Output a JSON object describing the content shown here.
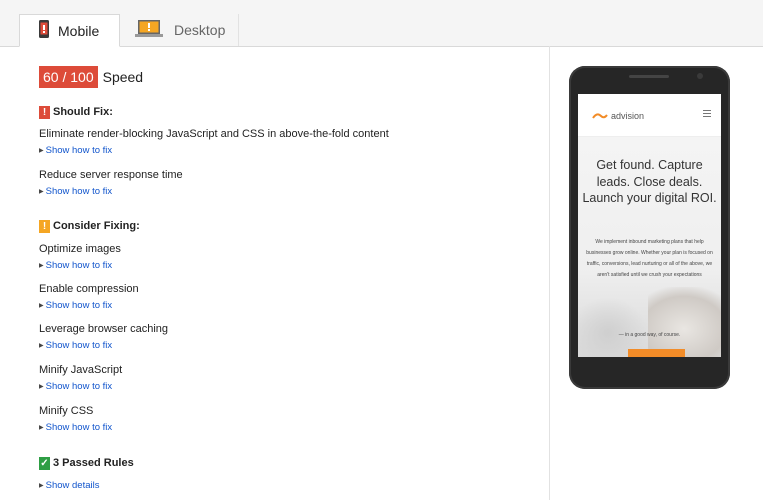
{
  "tabs": [
    {
      "label": "Mobile",
      "icon": "mobile-icon",
      "active": true
    },
    {
      "label": "Desktop",
      "icon": "desktop-icon",
      "active": false
    }
  ],
  "score": {
    "value": "60 / 100",
    "label": "Speed",
    "color": "#dd4b39"
  },
  "should_fix": {
    "heading": "Should Fix:",
    "badge_color": "#dd4b39",
    "rules": [
      {
        "title": "Eliminate render-blocking JavaScript and CSS in above-the-fold content",
        "link": "Show how to fix"
      },
      {
        "title": "Reduce server response time",
        "link": "Show how to fix"
      }
    ]
  },
  "consider_fixing": {
    "heading": "Consider Fixing:",
    "badge_color": "#f5a623",
    "rules": [
      {
        "title": "Optimize images",
        "link": "Show how to fix"
      },
      {
        "title": "Enable compression",
        "link": "Show how to fix"
      },
      {
        "title": "Leverage browser caching",
        "link": "Show how to fix"
      },
      {
        "title": "Minify JavaScript",
        "link": "Show how to fix"
      },
      {
        "title": "Minify CSS",
        "link": "Show how to fix"
      }
    ]
  },
  "passed": {
    "heading": "3 Passed Rules",
    "link": "Show details",
    "badge_color": "#2e9e44"
  },
  "preview": {
    "logo_text": "advision",
    "headline": "Get found. Capture leads. Close deals. Launch your digital ROI.",
    "body": "We implement inbound marketing plans that help businesses grow online. Whether your plan is focused on traffic, conversions, lead nurturing or all of the above, we aren't satisfied until we crush your expectations",
    "tagline": "— in a good way, of course.",
    "accent": "#f28c28"
  }
}
